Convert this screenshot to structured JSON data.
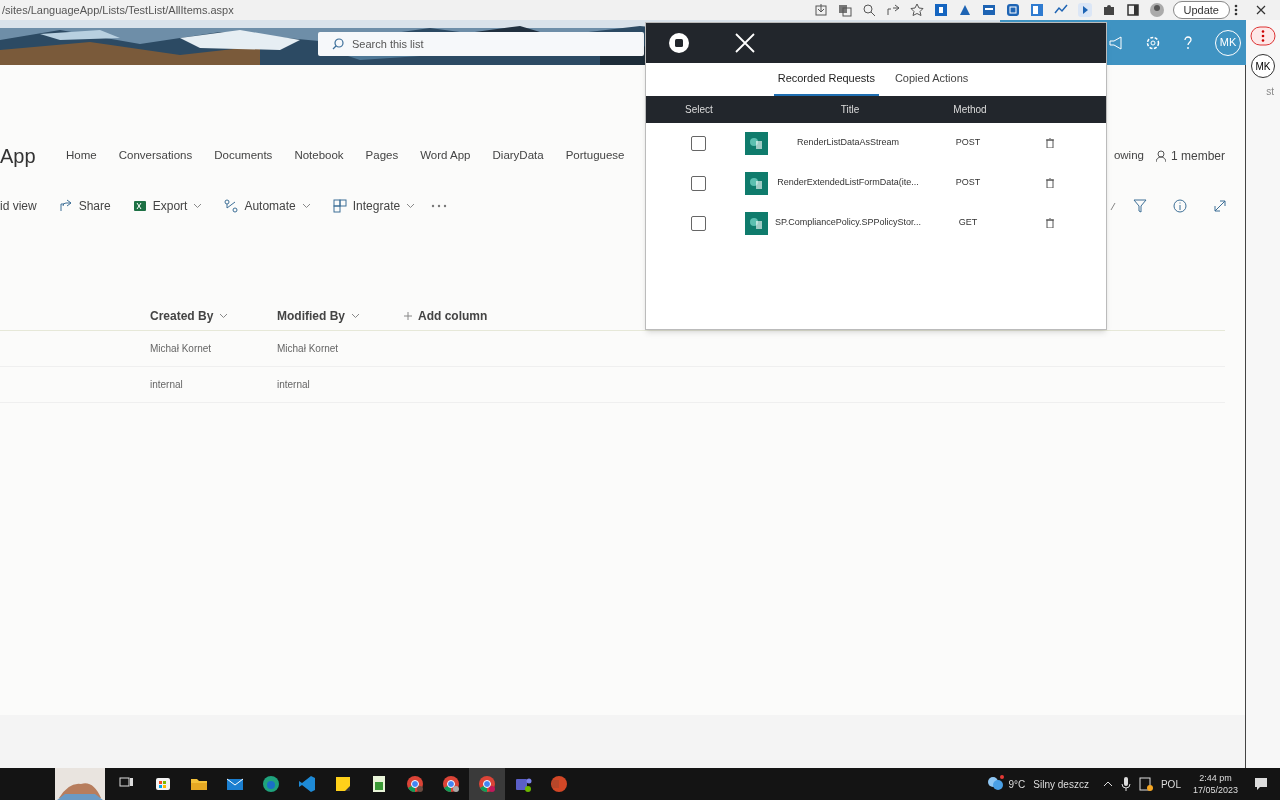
{
  "browser": {
    "url": "/sites/LanguageApp/Lists/TestList/AllItems.aspx",
    "update_button": "Update"
  },
  "site_header": {
    "search_placeholder": "Search this list",
    "avatar": "MK"
  },
  "site": {
    "title": "App",
    "nav": [
      "Home",
      "Conversations",
      "Documents",
      "Notebook",
      "Pages",
      "Word App",
      "DiaryData",
      "Portuguese"
    ],
    "following": "owing",
    "members": "1 member"
  },
  "command_bar": [
    {
      "label": "id view",
      "kind": "plain"
    },
    {
      "label": "Share",
      "kind": "share"
    },
    {
      "label": "Export",
      "kind": "excel"
    },
    {
      "label": "Automate",
      "kind": "automate"
    },
    {
      "label": "Integrate",
      "kind": "integrate"
    }
  ],
  "list": {
    "columns": [
      "Created By",
      "Modified By"
    ],
    "add_column": "Add column",
    "rows": [
      [
        "Michał Kornet",
        "Michał Kornet"
      ],
      [
        "internal",
        "internal"
      ]
    ]
  },
  "panel": {
    "tabs": [
      {
        "label": "Recorded Requests",
        "selected": true
      },
      {
        "label": "Copied Actions",
        "selected": false
      }
    ],
    "columns": [
      "Select",
      "Title",
      "Method"
    ],
    "rows": [
      {
        "title": "RenderListDataAsStream",
        "method": "POST",
        "checked": false
      },
      {
        "title": "RenderExtendedListFormData(ite...",
        "method": "POST",
        "checked": false
      },
      {
        "title": "SP.CompliancePolicy.SPPolicyStor...",
        "method": "GET",
        "checked": false
      }
    ]
  },
  "side_strip": {
    "avatar": "MK",
    "text": "st"
  },
  "taskbar": {
    "apps": [
      {
        "selected": false
      },
      {
        "selected": false
      },
      {
        "selected": false
      },
      {
        "selected": false
      },
      {
        "selected": false
      },
      {
        "selected": false
      },
      {
        "selected": false
      },
      {
        "selected": false
      },
      {
        "selected": false
      },
      {
        "selected": false
      },
      {
        "selected": true
      },
      {
        "selected": false
      },
      {
        "selected": false
      }
    ],
    "temperature": "9°C",
    "weather": "Silny deszcz",
    "language": "POL",
    "time": "2:44 pm",
    "date": "17/05/2023"
  }
}
